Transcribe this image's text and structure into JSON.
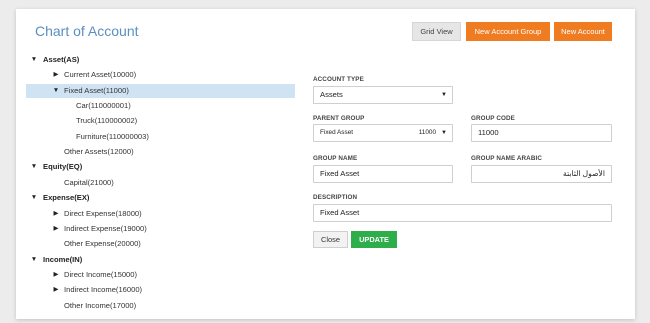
{
  "header": {
    "title": "Chart of Account",
    "grid_view_label": "Grid View",
    "new_group_label": "New Account Group",
    "new_account_label": "New Account"
  },
  "tree": [
    {
      "label": "Asset(AS)",
      "level": 0,
      "toggle": "▼",
      "bold": true,
      "selected": false
    },
    {
      "label": "Current Asset(10000)",
      "level": 1,
      "toggle": "▶",
      "bold": false,
      "selected": false
    },
    {
      "label": "Fixed Asset(11000)",
      "level": 1,
      "toggle": "▼",
      "bold": false,
      "selected": true
    },
    {
      "label": "Car(110000001)",
      "level": 2,
      "toggle": "",
      "bold": false,
      "selected": false
    },
    {
      "label": "Truck(110000002)",
      "level": 2,
      "toggle": "",
      "bold": false,
      "selected": false
    },
    {
      "label": "Furniture(110000003)",
      "level": 2,
      "toggle": "",
      "bold": false,
      "selected": false
    },
    {
      "label": "Other Assets(12000)",
      "level": 1,
      "toggle": "",
      "bold": false,
      "selected": false
    },
    {
      "label": "Equity(EQ)",
      "level": 0,
      "toggle": "▼",
      "bold": true,
      "selected": false
    },
    {
      "label": "Capital(21000)",
      "level": 1,
      "toggle": "",
      "bold": false,
      "selected": false
    },
    {
      "label": "Expense(EX)",
      "level": 0,
      "toggle": "▼",
      "bold": true,
      "selected": false
    },
    {
      "label": "Direct Expense(18000)",
      "level": 1,
      "toggle": "▶",
      "bold": false,
      "selected": false
    },
    {
      "label": "Indirect Expense(19000)",
      "level": 1,
      "toggle": "▶",
      "bold": false,
      "selected": false
    },
    {
      "label": "Other Expense(20000)",
      "level": 1,
      "toggle": "",
      "bold": false,
      "selected": false
    },
    {
      "label": "Income(IN)",
      "level": 0,
      "toggle": "▼",
      "bold": true,
      "selected": false
    },
    {
      "label": "Direct Income(15000)",
      "level": 1,
      "toggle": "▶",
      "bold": false,
      "selected": false
    },
    {
      "label": "Indirect Income(16000)",
      "level": 1,
      "toggle": "▶",
      "bold": false,
      "selected": false
    },
    {
      "label": "Other Income(17000)",
      "level": 1,
      "toggle": "",
      "bold": false,
      "selected": false
    }
  ],
  "form": {
    "account_type_label": "ACCOUNT TYPE",
    "account_type_value": "Assets",
    "parent_group_label": "PARENT GROUP",
    "parent_group_value": "Fixed Asset",
    "parent_group_code": "11000",
    "group_code_label": "GROUP CODE",
    "group_code_value": "11000",
    "group_name_label": "GROUP NAME",
    "group_name_value": "Fixed Asset",
    "group_name_arabic_label": "GROUP NAME ARABIC",
    "group_name_arabic_value": "الأصول الثابتة",
    "description_label": "DESCRIPTION",
    "description_value": "Fixed Asset",
    "close_label": "Close",
    "update_label": "UPDATE"
  },
  "colors": {
    "accent_orange": "#f07c22",
    "title_blue": "#5a8fbf",
    "selected_row": "#cfe3f3",
    "update_green": "#2eae4a"
  }
}
